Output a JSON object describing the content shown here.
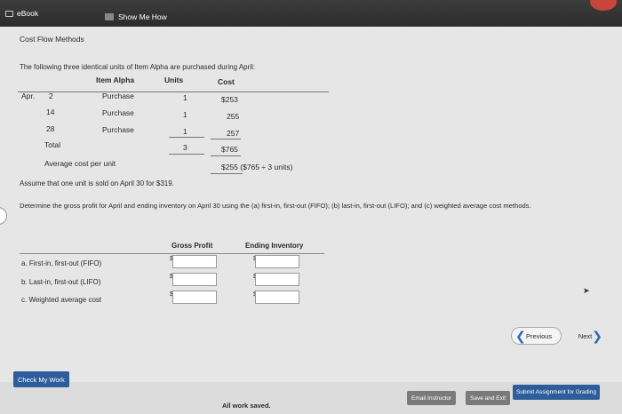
{
  "topbar": {
    "ebook_label": "eBook",
    "showme_label": "Show Me How"
  },
  "problem": {
    "title": "Cost Flow Methods",
    "intro": "The following three identical units of Item Alpha are purchased during April:",
    "table": {
      "headers": {
        "item": "Item Alpha",
        "units": "Units",
        "cost": "Cost"
      },
      "rows": [
        {
          "month": "Apr.",
          "day": "2",
          "desc": "Purchase",
          "units": "1",
          "cost": "$253"
        },
        {
          "month": "",
          "day": "14",
          "desc": "Purchase",
          "units": "1",
          "cost": "255"
        },
        {
          "month": "",
          "day": "28",
          "desc": "Purchase",
          "units": "1",
          "cost": "257"
        }
      ],
      "total": {
        "label": "Total",
        "units": "3",
        "cost": "$765"
      },
      "average": {
        "label": "Average cost per unit",
        "value": "$255 ($765 ÷ 3 units)"
      }
    },
    "assume": "Assume that one unit is sold on April 30 for $319.",
    "question": "Determine the gross profit for April and ending inventory on April 30 using the (a) first-in, first-out (FIFO); (b) last-in, first-out (LIFO); and (c) weighted average cost methods."
  },
  "answer": {
    "headers": {
      "gross": "Gross Profit",
      "ending": "Ending Inventory"
    },
    "dollar": "$",
    "rows": [
      {
        "label": "a. First-in, first-out (FIFO)",
        "gross_value": "",
        "ending_value": ""
      },
      {
        "label": "b. Last-in, first-out (LIFO)",
        "gross_value": "",
        "ending_value": ""
      },
      {
        "label": "c. Weighted average cost",
        "gross_value": "",
        "ending_value": ""
      }
    ]
  },
  "nav": {
    "previous": "Previous",
    "next": "Next"
  },
  "footer": {
    "check_work": "Check My Work",
    "status": "All work saved.",
    "email": "Email Instructor",
    "save_exit": "Save and Exit",
    "submit": "Submit Assignment for Grading"
  }
}
